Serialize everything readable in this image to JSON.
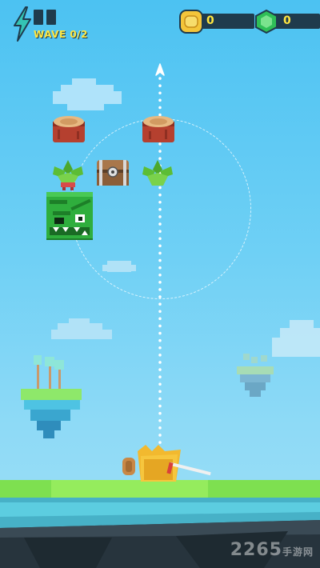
{
  "hud": {
    "wave_text": "WAVE 0/2",
    "coins": "0",
    "gems": "0",
    "energy_icon": "lightning-icon",
    "coin_icon": "coin-icon",
    "gem_icon": "gem-icon"
  },
  "watermark": {
    "brand": "2265",
    "sub": "手游网"
  },
  "colors": {
    "sky": "#5ec8f2",
    "grass": "#7ee050",
    "hud_dark": "#1f3b4d",
    "hud_yellow": "#ffe640"
  }
}
